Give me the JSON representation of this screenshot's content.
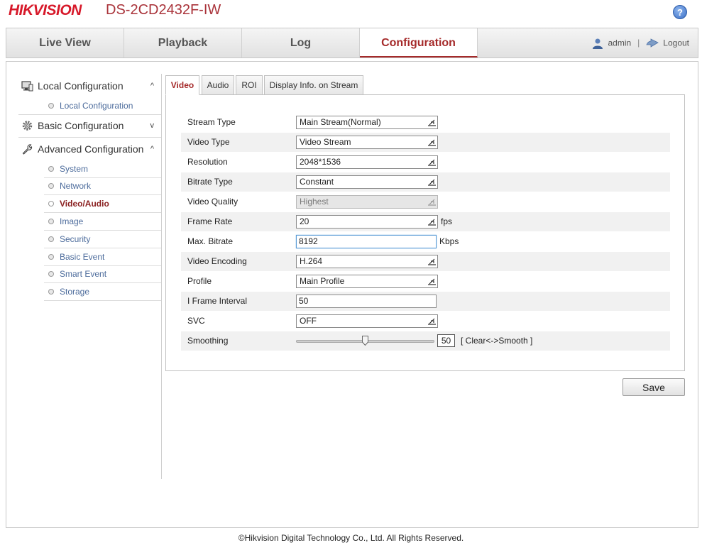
{
  "header": {
    "brand": "HIKVISION",
    "model": "DS-2CD2432F-IW",
    "help_glyph": "?"
  },
  "nav": {
    "tabs": [
      {
        "label": "Live View"
      },
      {
        "label": "Playback"
      },
      {
        "label": "Log"
      },
      {
        "label": "Configuration",
        "active": true
      }
    ],
    "user": "admin",
    "separator": "|",
    "logout": "Logout"
  },
  "sidebar": {
    "sections": [
      {
        "label": "Local Configuration",
        "chevron": "^",
        "items": [
          "Local Configuration"
        ]
      },
      {
        "label": "Basic Configuration",
        "chevron": "v",
        "items": []
      },
      {
        "label": "Advanced Configuration",
        "chevron": "^",
        "items": [
          "System",
          "Network",
          "Video/Audio",
          "Image",
          "Security",
          "Basic Event",
          "Smart Event",
          "Storage"
        ],
        "active_item": "Video/Audio"
      }
    ]
  },
  "subtabs": [
    {
      "label": "Video",
      "active": true
    },
    {
      "label": "Audio"
    },
    {
      "label": "ROI"
    },
    {
      "label": "Display Info. on Stream"
    }
  ],
  "form": {
    "stream_type": {
      "label": "Stream Type",
      "value": "Main Stream(Normal)"
    },
    "video_type": {
      "label": "Video Type",
      "value": "Video Stream"
    },
    "resolution": {
      "label": "Resolution",
      "value": "2048*1536"
    },
    "bitrate_type": {
      "label": "Bitrate Type",
      "value": "Constant"
    },
    "video_quality": {
      "label": "Video Quality",
      "value": "Highest"
    },
    "frame_rate": {
      "label": "Frame Rate",
      "value": "20",
      "unit": "fps"
    },
    "max_bitrate": {
      "label": "Max. Bitrate",
      "value": "8192",
      "unit": "Kbps"
    },
    "video_encoding": {
      "label": "Video Encoding",
      "value": "H.264"
    },
    "profile": {
      "label": "Profile",
      "value": "Main Profile"
    },
    "i_frame_interval": {
      "label": "I Frame Interval",
      "value": "50"
    },
    "svc": {
      "label": "SVC",
      "value": "OFF"
    },
    "smoothing": {
      "label": "Smoothing",
      "value": "50",
      "level": 50,
      "note": "[ Clear<->Smooth ]"
    }
  },
  "save_label": "Save",
  "footer": "©Hikvision Digital Technology Co., Ltd. All Rights Reserved.",
  "colors": {
    "brand": "#d7192a",
    "accent": "#a52a2a",
    "link": "#4d6c9c"
  }
}
